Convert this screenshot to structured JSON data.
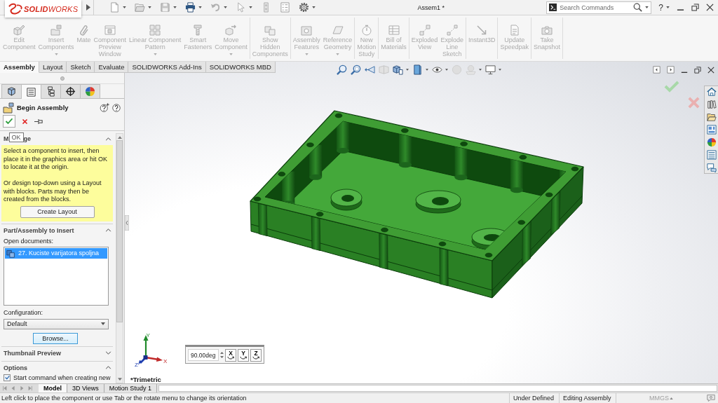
{
  "title_bar": {
    "logo": "**SOLID**WORKS",
    "title": "Assem1 *",
    "search": {
      "placeholder": "Search Commands"
    },
    "help": "?"
  },
  "command_manager": {
    "groups": [
      {
        "buttons": [
          {
            "label": "Edit\nComponent",
            "dropdown": false,
            "disabled": true
          },
          {
            "label": "Insert\nComponents",
            "dropdown": true,
            "disabled": true
          },
          {
            "label": "Mate",
            "dropdown": false,
            "disabled": true
          },
          {
            "label": "Component\nPreview\nWindow",
            "dropdown": false,
            "disabled": true
          },
          {
            "label": "Linear Component\nPattern",
            "dropdown": true,
            "disabled": true
          },
          {
            "label": "Smart\nFasteners",
            "dropdown": false,
            "disabled": true
          },
          {
            "label": "Move\nComponent",
            "dropdown": true,
            "disabled": true
          }
        ]
      },
      {
        "buttons": [
          {
            "label": "Show\nHidden\nComponents",
            "dropdown": false,
            "disabled": true
          }
        ]
      },
      {
        "buttons": [
          {
            "label": "Assembly\nFeatures",
            "dropdown": true,
            "disabled": true
          },
          {
            "label": "Reference\nGeometry",
            "dropdown": true,
            "disabled": true
          }
        ]
      },
      {
        "buttons": [
          {
            "label": "New\nMotion\nStudy",
            "dropdown": false,
            "disabled": true
          }
        ]
      },
      {
        "buttons": [
          {
            "label": "Bill of\nMaterials",
            "dropdown": false,
            "disabled": true
          }
        ]
      },
      {
        "buttons": [
          {
            "label": "Exploded\nView",
            "dropdown": false,
            "disabled": true
          },
          {
            "label": "Explode\nLine\nSketch",
            "dropdown": false,
            "disabled": true
          }
        ]
      },
      {
        "buttons": [
          {
            "label": "Instant3D",
            "dropdown": false,
            "disabled": true
          }
        ]
      },
      {
        "buttons": [
          {
            "label": "Update\nSpeedpak",
            "dropdown": false,
            "disabled": true
          }
        ]
      },
      {
        "buttons": [
          {
            "label": "Take\nSnapshot",
            "dropdown": false,
            "disabled": true
          }
        ]
      }
    ]
  },
  "ribbon_tabs": [
    {
      "label": "Assembly",
      "selected": true
    },
    {
      "label": "Layout",
      "selected": false
    },
    {
      "label": "Sketch",
      "selected": false
    },
    {
      "label": "Evaluate",
      "selected": false
    },
    {
      "label": "SOLIDWORKS Add-Ins",
      "selected": false
    },
    {
      "label": "SOLIDWORKS MBD",
      "selected": false
    }
  ],
  "property_manager": {
    "tabs": [
      {
        "selected": false
      },
      {
        "selected": true
      },
      {
        "selected": false
      },
      {
        "selected": false
      },
      {
        "selected": false
      }
    ],
    "title": "Begin Assembly",
    "tooltip": "OK",
    "message": {
      "title_parts": [
        "M",
        "ge"
      ],
      "expanded": true,
      "paragraphs": [
        "Select a component to insert, then place it in the graphics area or hit OK to locate it at the origin.",
        "Or design top-down using a Layout with blocks. Parts may then be created from the blocks."
      ],
      "button": "Create Layout"
    },
    "part_to_insert": {
      "title": "Part/Assembly to Insert",
      "expanded": true,
      "documents_label": "Open documents:",
      "documents": [
        {
          "name": "27. Kuciste varijatora spoljna",
          "selected": true
        }
      ],
      "configuration_label": "Configuration:",
      "configuration": "Default",
      "browse": "Browse..."
    },
    "thumbnail_preview": {
      "title": "Thumbnail Preview",
      "expanded": false
    },
    "options": {
      "title": "Options",
      "expanded": true,
      "items": [
        {
          "label": "Start command when creating new",
          "checked": true
        }
      ]
    }
  },
  "graphics": {
    "view_name": "*Trimetric",
    "triad": {
      "x": "X",
      "y": "Y",
      "z": "Z"
    },
    "rotate": {
      "value": "90.00deg",
      "axes": [
        {
          "label": "X"
        },
        {
          "label": "Y"
        },
        {
          "label": "Z"
        }
      ]
    }
  },
  "bottom_tabs": [
    {
      "label": "Model",
      "selected": true
    },
    {
      "label": "3D Views",
      "selected": false
    },
    {
      "label": "Motion Study 1",
      "selected": false
    }
  ],
  "status_bar": {
    "message": "Left click to place the component or use Tab or the rotate menu to change its orientation",
    "state": "Under Defined",
    "mode": "Editing Assembly",
    "units": "MMGS"
  }
}
